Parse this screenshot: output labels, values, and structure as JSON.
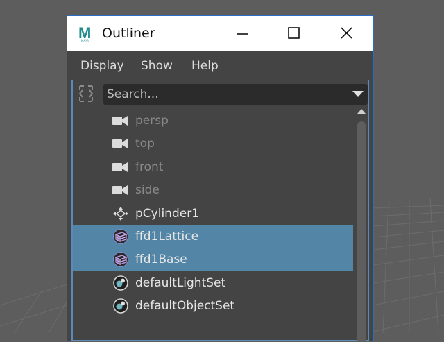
{
  "window": {
    "title": "Outliner",
    "app_icon_letter": "M",
    "app_icon_subtext": "MAYA",
    "accent_color": "#2b6cc4"
  },
  "menu": {
    "items": [
      {
        "label": "Display"
      },
      {
        "label": "Show"
      },
      {
        "label": "Help"
      }
    ]
  },
  "search": {
    "placeholder": "Search..."
  },
  "outliner": {
    "items": [
      {
        "label": "persp",
        "icon": "camera-icon",
        "dim": true,
        "selected": false
      },
      {
        "label": "top",
        "icon": "camera-icon",
        "dim": true,
        "selected": false
      },
      {
        "label": "front",
        "icon": "camera-icon",
        "dim": true,
        "selected": false
      },
      {
        "label": "side",
        "icon": "camera-icon",
        "dim": true,
        "selected": false
      },
      {
        "label": "pCylinder1",
        "icon": "transform-icon",
        "dim": false,
        "selected": false
      },
      {
        "label": "ffd1Lattice",
        "icon": "lattice-icon",
        "dim": false,
        "selected": true
      },
      {
        "label": "ffd1Base",
        "icon": "lattice-icon",
        "dim": false,
        "selected": true
      },
      {
        "label": "defaultLightSet",
        "icon": "set-icon",
        "dim": false,
        "selected": false
      },
      {
        "label": "defaultObjectSet",
        "icon": "set-icon",
        "dim": false,
        "selected": false
      }
    ],
    "selection_color": "#5285a6"
  }
}
